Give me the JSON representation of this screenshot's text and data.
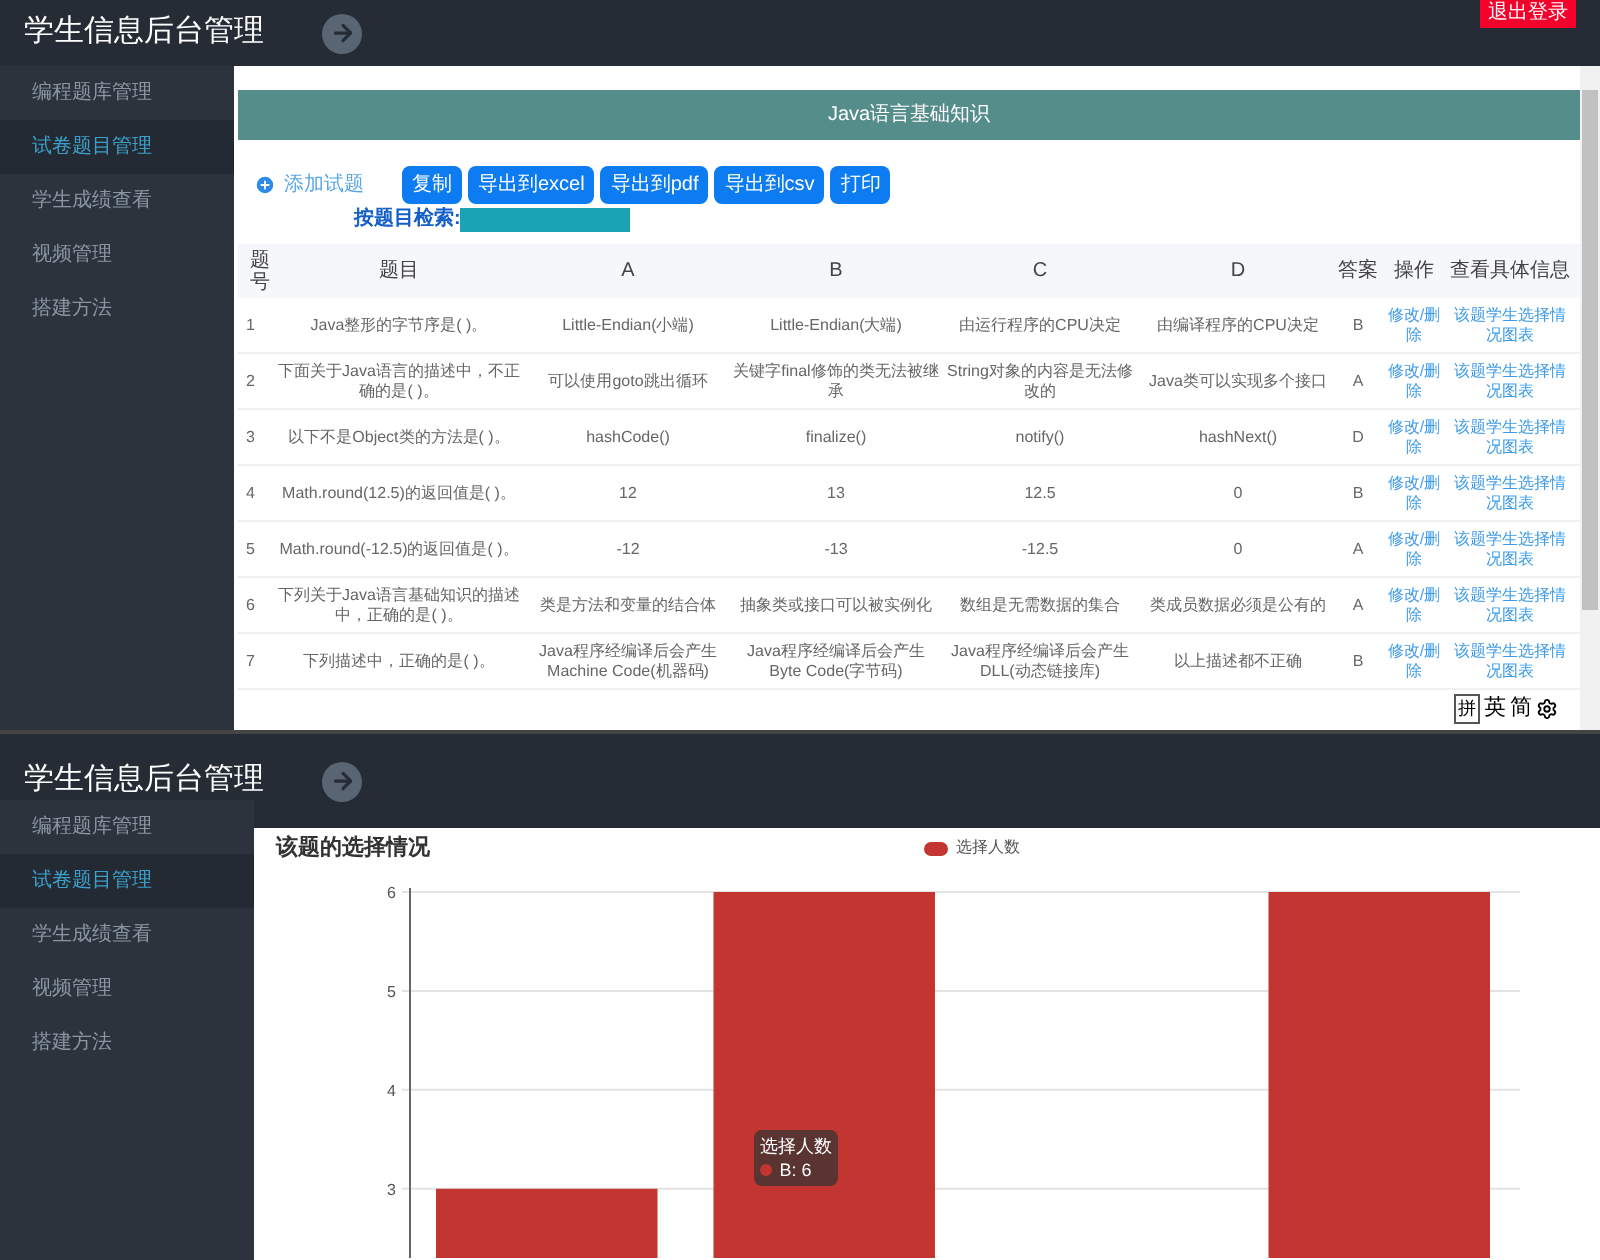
{
  "table_view": {
    "app_title": "学生信息后台管理",
    "logout": "退出登录",
    "sidebar": [
      {
        "label": "编程题库管理",
        "selected": false
      },
      {
        "label": "试卷题目管理",
        "selected": true
      },
      {
        "label": "学生成绩查看",
        "selected": false
      },
      {
        "label": "视频管理",
        "selected": false
      },
      {
        "label": "搭建方法",
        "selected": false
      }
    ],
    "banner": "Java语言基础知识",
    "add_link": "添加试题",
    "buttons": [
      "复制",
      "导出到excel",
      "导出到pdf",
      "导出到csv",
      "打印"
    ],
    "search_label": "按题目检索:",
    "columns": [
      "题号",
      "题目",
      "A",
      "B",
      "C",
      "D",
      "答案",
      "操作",
      "查看具体信息"
    ],
    "rows": [
      [
        "1",
        "Java整形的字节序是( )。",
        "Little-Endian(小端)",
        "Little-Endian(大端)",
        "由运行程序的CPU决定",
        "由编译程序的CPU决定",
        "B",
        "修改/删除",
        "该题学生选择情况图表"
      ],
      [
        "2",
        "下面关于Java语言的描述中，不正确的是( )。",
        "可以使用goto跳出循环",
        "关键字final修饰的类无法被继承",
        "String对象的内容是无法修改的",
        "Java类可以实现多个接口",
        "A",
        "修改/删除",
        "该题学生选择情况图表"
      ],
      [
        "3",
        "以下不是Object类的方法是( )。",
        "hashCode()",
        "finalize()",
        "notify()",
        "hashNext()",
        "D",
        "修改/删除",
        "该题学生选择情况图表"
      ],
      [
        "4",
        "Math.round(12.5)的返回值是( )。",
        "12",
        "13",
        "12.5",
        "0",
        "B",
        "修改/删除",
        "该题学生选择情况图表"
      ],
      [
        "5",
        "Math.round(-12.5)的返回值是( )。",
        "-12",
        "-13",
        "-12.5",
        "0",
        "A",
        "修改/删除",
        "该题学生选择情况图表"
      ],
      [
        "6",
        "下列关于Java语言基础知识的描述中，正确的是( )。",
        "类是方法和变量的结合体",
        "抽象类或接口可以被实例化",
        "数组是无需数据的集合",
        "类成员数据必须是公有的",
        "A",
        "修改/删除",
        "该题学生选择情况图表"
      ],
      [
        "7",
        "下列描述中，正确的是( )。",
        "Java程序经编译后会产生Machine Code(机器码)",
        "Java程序经编译后会产生Byte Code(字节码)",
        "Java程序经编译后会产生DLL(动态链接库)",
        "以上描述都不正确",
        "B",
        "修改/删除",
        "该题学生选择情况图表"
      ]
    ],
    "ime_toolbar": [
      "拼",
      "英",
      "简"
    ]
  },
  "chart_view": {
    "app_title": "学生信息后台管理",
    "sidebar": [
      {
        "label": "编程题库管理",
        "selected": false
      },
      {
        "label": "试卷题目管理",
        "selected": true
      },
      {
        "label": "学生成绩查看",
        "selected": false
      },
      {
        "label": "视频管理",
        "selected": false
      },
      {
        "label": "搭建方法",
        "selected": false
      }
    ],
    "chart_data": {
      "type": "bar",
      "title": "该题的选择情况",
      "ylim": [
        2.3,
        6
      ],
      "grid": true,
      "yticks": [
        3,
        4,
        5,
        6
      ],
      "series": [
        {
          "name": "选择人数",
          "color": "#c23531",
          "values": [
            3,
            6,
            null,
            6
          ]
        }
      ]
    },
    "tooltip": {
      "title": "选择人数",
      "text": "B: 6"
    }
  }
}
